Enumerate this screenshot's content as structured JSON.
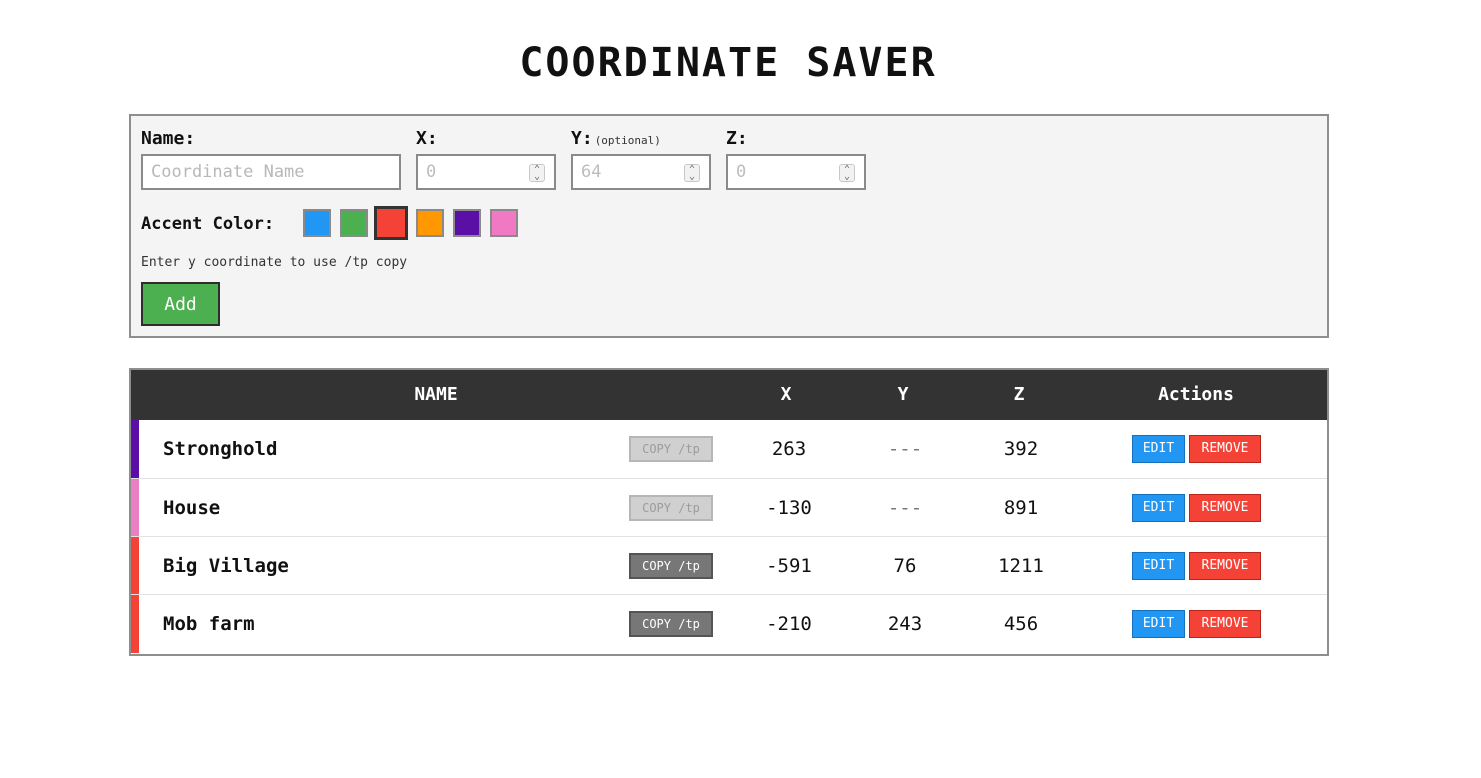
{
  "app": {
    "title": "COORDINATE SAVER"
  },
  "form": {
    "name_label": "Name:",
    "name_placeholder": "Coordinate Name",
    "x_label": "X:",
    "x_placeholder": "0",
    "y_label": "Y:",
    "y_optional": "(optional)",
    "y_placeholder": "64",
    "z_label": "Z:",
    "z_placeholder": "0",
    "accent_label": "Accent Color:",
    "accent_colors": [
      "#2196f3",
      "#4caf50",
      "#f44336",
      "#ff9800",
      "#5b0fa6",
      "#f178c3"
    ],
    "accent_selected": "#f44336",
    "hint": "Enter y coordinate to use /tp copy",
    "add_label": "Add"
  },
  "table": {
    "headers": {
      "name": "NAME",
      "x": "X",
      "y": "Y",
      "z": "Z",
      "actions": "Actions"
    },
    "copy_label": "COPY /tp",
    "edit_label": "EDIT",
    "remove_label": "REMOVE",
    "rows": [
      {
        "name": "Stronghold",
        "x": "263",
        "y": "---",
        "z": "392",
        "color": "#5b0fa6",
        "copy_enabled": false
      },
      {
        "name": "House",
        "x": "-130",
        "y": "---",
        "z": "891",
        "color": "#ea7fc4",
        "copy_enabled": false
      },
      {
        "name": "Big Village",
        "x": "-591",
        "y": "76",
        "z": "1211",
        "color": "#f44336",
        "copy_enabled": true
      },
      {
        "name": "Mob farm",
        "x": "-210",
        "y": "243",
        "z": "456",
        "color": "#f44336",
        "copy_enabled": true
      }
    ]
  }
}
